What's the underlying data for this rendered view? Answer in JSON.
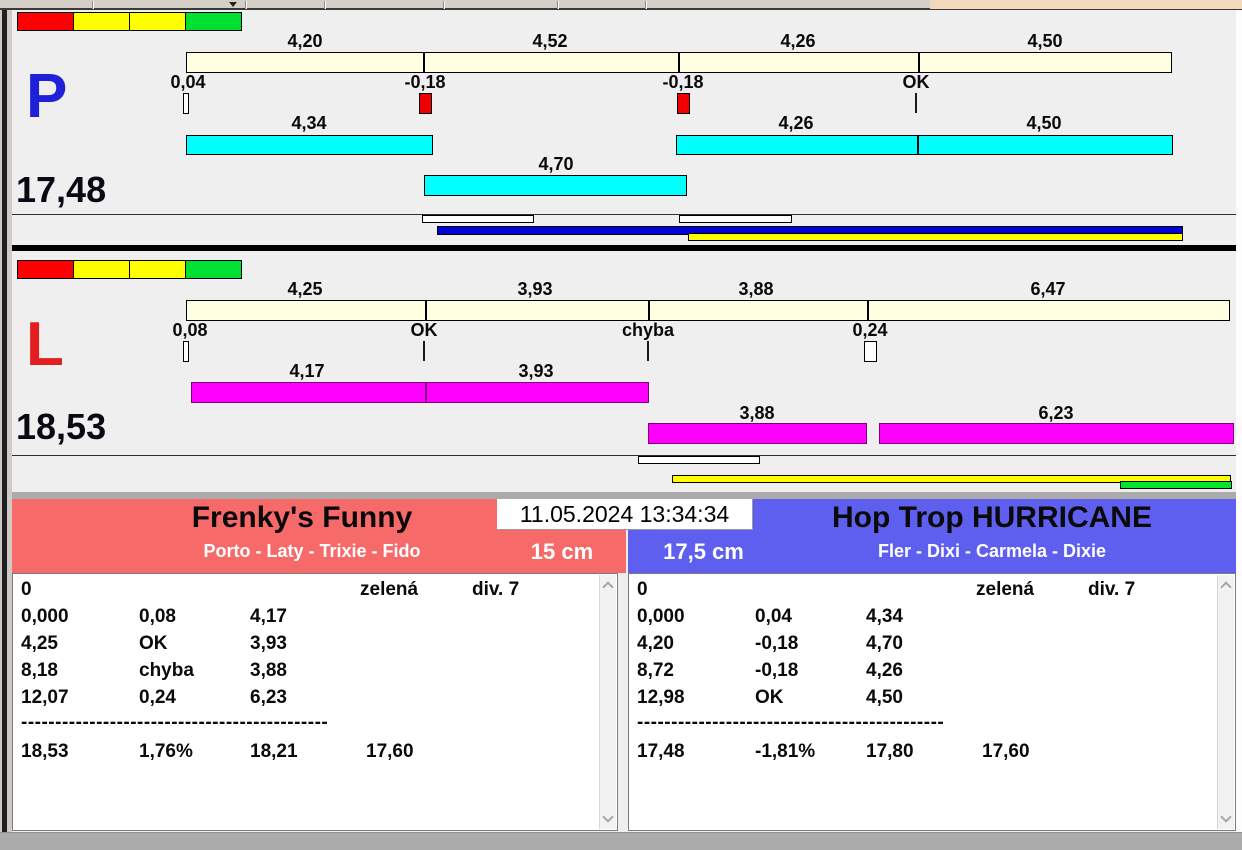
{
  "colors": {
    "lane_bg": "#efefef",
    "scale_ivory": "#ffffe1",
    "lane_p_accent": "#00ffff",
    "lane_l_accent": "#ff00ff",
    "lane_p_letter": "#2020d8",
    "lane_l_letter": "#e31e1e",
    "progress_blue": "#0000d9",
    "progress_yellow": "#ffff00",
    "progress_green": "#00e62e",
    "fault_red": "#ee0000",
    "team_left_bg": "#f76a6a",
    "team_right_bg": "#5f5fef",
    "lights": [
      "#ff0000",
      "#ffff00",
      "#ffff00",
      "#00e033"
    ]
  },
  "panel_p": {
    "letter": "P",
    "total": "17,48",
    "split_labels": [
      "4,20",
      "4,52",
      "4,26",
      "4,50"
    ],
    "change_labels": [
      "0,04",
      "-0,18",
      "-0,18",
      "OK"
    ],
    "run_labels": [
      "4,34",
      "4,26",
      "4,50"
    ],
    "rerun_label": "4,70"
  },
  "panel_l": {
    "letter": "L",
    "total": "18,53",
    "split_labels": [
      "4,25",
      "3,93",
      "3,88",
      "6,47"
    ],
    "change_labels": [
      "0,08",
      "OK",
      "chyba",
      "0,24"
    ],
    "run_labels": [
      "4,17",
      "3,93"
    ],
    "rerun_labels": [
      "3,88",
      "6,23"
    ]
  },
  "footer": {
    "datetime": "11.05.2024 13:34:34",
    "left": {
      "team": "Frenky's Funny",
      "dogs": "Porto - Laty - Trixie - Fido",
      "jump_height": "15 cm",
      "head": [
        "0",
        "zelená",
        "div. 7"
      ],
      "rows": [
        [
          "0,000",
          "0,08",
          "4,17"
        ],
        [
          "4,25",
          "OK",
          "3,93"
        ],
        [
          "8,18",
          "chyba",
          "3,88"
        ],
        [
          "12,07",
          "0,24",
          "6,23"
        ]
      ],
      "separator": "---------------------------------------------",
      "totals": [
        "18,53",
        "1,76%",
        "18,21",
        "17,60"
      ]
    },
    "right": {
      "team": "Hop Trop HURRICANE",
      "dogs": "Fler - Dixi - Carmela - Dixie",
      "jump_height": "17,5 cm",
      "head": [
        "0",
        "zelená",
        "div. 7"
      ],
      "rows": [
        [
          "0,000",
          "0,04",
          "4,34"
        ],
        [
          "4,20",
          "-0,18",
          "4,70"
        ],
        [
          "8,72",
          "-0,18",
          "4,26"
        ],
        [
          "12,98",
          "OK",
          "4,50"
        ]
      ],
      "separator": "---------------------------------------------",
      "totals": [
        "17,48",
        "-1,81%",
        "17,80",
        "17,60"
      ]
    }
  }
}
